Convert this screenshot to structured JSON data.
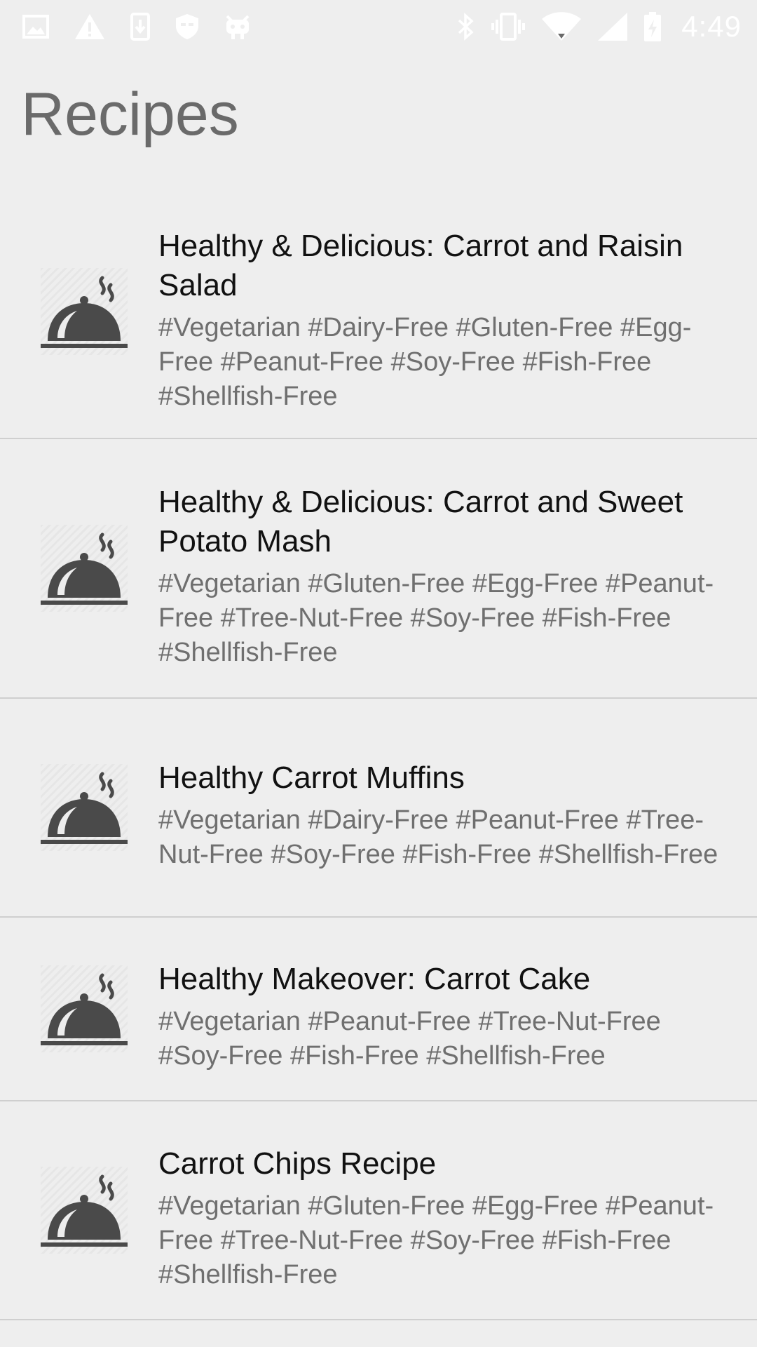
{
  "status_bar": {
    "time": "4:49",
    "left_icons": [
      "image-icon",
      "warning-icon",
      "download-icon",
      "shield-icon",
      "android-debug-icon"
    ],
    "right_icons": [
      "bluetooth-icon",
      "vibrate-icon",
      "wifi-icon",
      "signal-icon",
      "battery-icon"
    ]
  },
  "page": {
    "title": "Recipes"
  },
  "recipes": [
    {
      "title": "Healthy & Delicious: Carrot and Raisin Salad",
      "tags": "#Vegetarian #Dairy-Free #Gluten-Free #Egg-Free #Peanut-Free #Soy-Free #Fish-Free #Shellfish-Free",
      "icon": "cloche-icon"
    },
    {
      "title": "Healthy & Delicious: Carrot and Sweet Potato Mash",
      "tags": "#Vegetarian #Gluten-Free #Egg-Free #Peanut-Free #Tree-Nut-Free #Soy-Free #Fish-Free #Shellfish-Free",
      "icon": "cloche-icon"
    },
    {
      "title": "Healthy Carrot Muffins",
      "tags": "#Vegetarian #Dairy-Free #Peanut-Free #Tree-Nut-Free #Soy-Free #Fish-Free #Shellfish-Free",
      "icon": "cloche-icon"
    },
    {
      "title": "Healthy Makeover: Carrot Cake",
      "tags": "#Vegetarian #Peanut-Free #Tree-Nut-Free #Soy-Free #Fish-Free #Shellfish-Free",
      "icon": "cloche-icon"
    },
    {
      "title": "Carrot Chips Recipe",
      "tags": "#Vegetarian #Gluten-Free #Egg-Free #Peanut-Free #Tree-Nut-Free #Soy-Free #Fish-Free #Shellfish-Free",
      "icon": "cloche-icon"
    }
  ],
  "colors": {
    "background": "#eeeeee",
    "title_text": "#6a6a6a",
    "item_title": "#111111",
    "item_tags": "#6f6f6f",
    "divider": "#cfcfcf",
    "icon": "#4a4a4a",
    "status_icons": "#ffffff"
  }
}
